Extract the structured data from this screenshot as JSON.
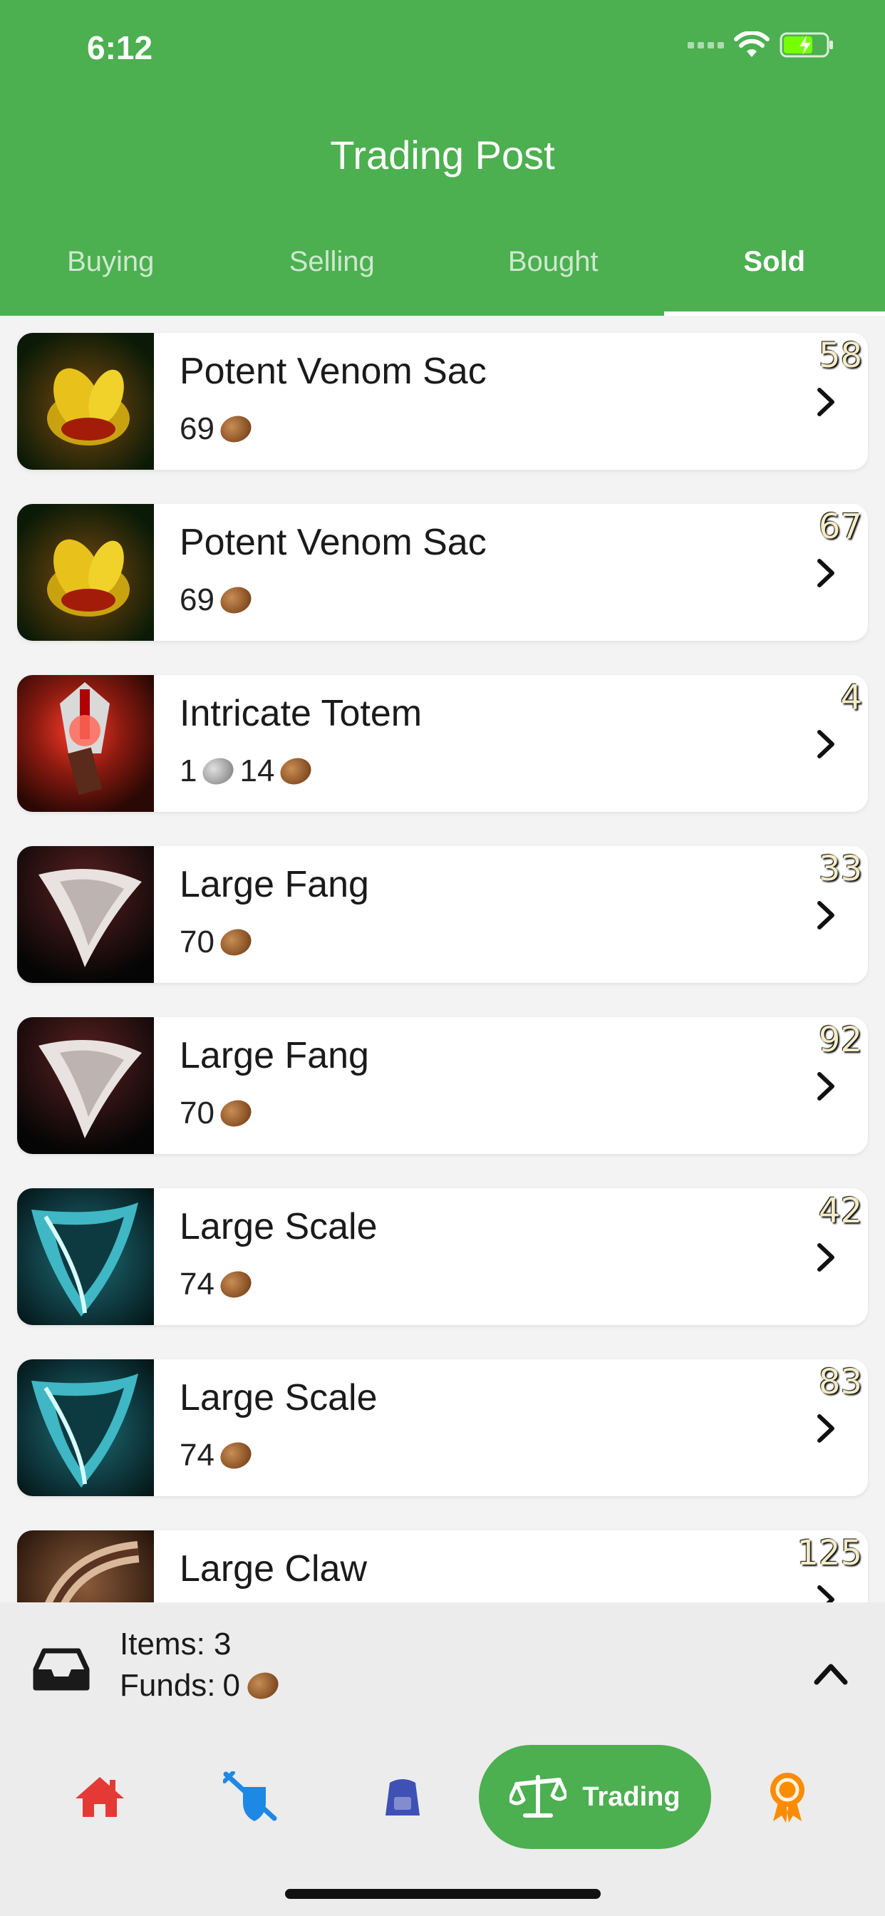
{
  "status_bar": {
    "time": "6:12"
  },
  "header": {
    "title": "Trading Post"
  },
  "tabs": [
    {
      "label": "Buying",
      "active": false
    },
    {
      "label": "Selling",
      "active": false
    },
    {
      "label": "Bought",
      "active": false
    },
    {
      "label": "Sold",
      "active": true
    }
  ],
  "items": [
    {
      "quantity": "58",
      "name": "Potent Venom Sac",
      "icon": "venom-sac-icon",
      "price": [
        {
          "amount": "69",
          "coin": "copper"
        }
      ]
    },
    {
      "quantity": "67",
      "name": "Potent Venom Sac",
      "icon": "venom-sac-icon",
      "price": [
        {
          "amount": "69",
          "coin": "copper"
        }
      ]
    },
    {
      "quantity": "4",
      "name": "Intricate Totem",
      "icon": "totem-icon",
      "price": [
        {
          "amount": "1",
          "coin": "silver"
        },
        {
          "amount": "14",
          "coin": "copper"
        }
      ]
    },
    {
      "quantity": "33",
      "name": "Large Fang",
      "icon": "fang-icon",
      "price": [
        {
          "amount": "70",
          "coin": "copper"
        }
      ]
    },
    {
      "quantity": "92",
      "name": "Large Fang",
      "icon": "fang-icon",
      "price": [
        {
          "amount": "70",
          "coin": "copper"
        }
      ]
    },
    {
      "quantity": "42",
      "name": "Large Scale",
      "icon": "scale-icon",
      "price": [
        {
          "amount": "74",
          "coin": "copper"
        }
      ]
    },
    {
      "quantity": "83",
      "name": "Large Scale",
      "icon": "scale-icon",
      "price": [
        {
          "amount": "74",
          "coin": "copper"
        }
      ]
    },
    {
      "quantity": "125",
      "name": "Large Claw",
      "icon": "claw-icon",
      "price": []
    }
  ],
  "summary": {
    "items_text": "Items: 3",
    "funds_label": "Funds:",
    "funds_amount": "0"
  },
  "nav": {
    "home": "home-icon",
    "pvp": "crossed-swords-shield-icon",
    "bag": "backpack-icon",
    "trading": {
      "label": "Trading",
      "icon": "scales-icon"
    },
    "achievements": "award-ribbon-icon"
  },
  "colors": {
    "accent": "#4caf50",
    "home": "#e53935",
    "pvp": "#1e88e5",
    "bag": "#3f51b5",
    "award": "#fb8c00"
  }
}
